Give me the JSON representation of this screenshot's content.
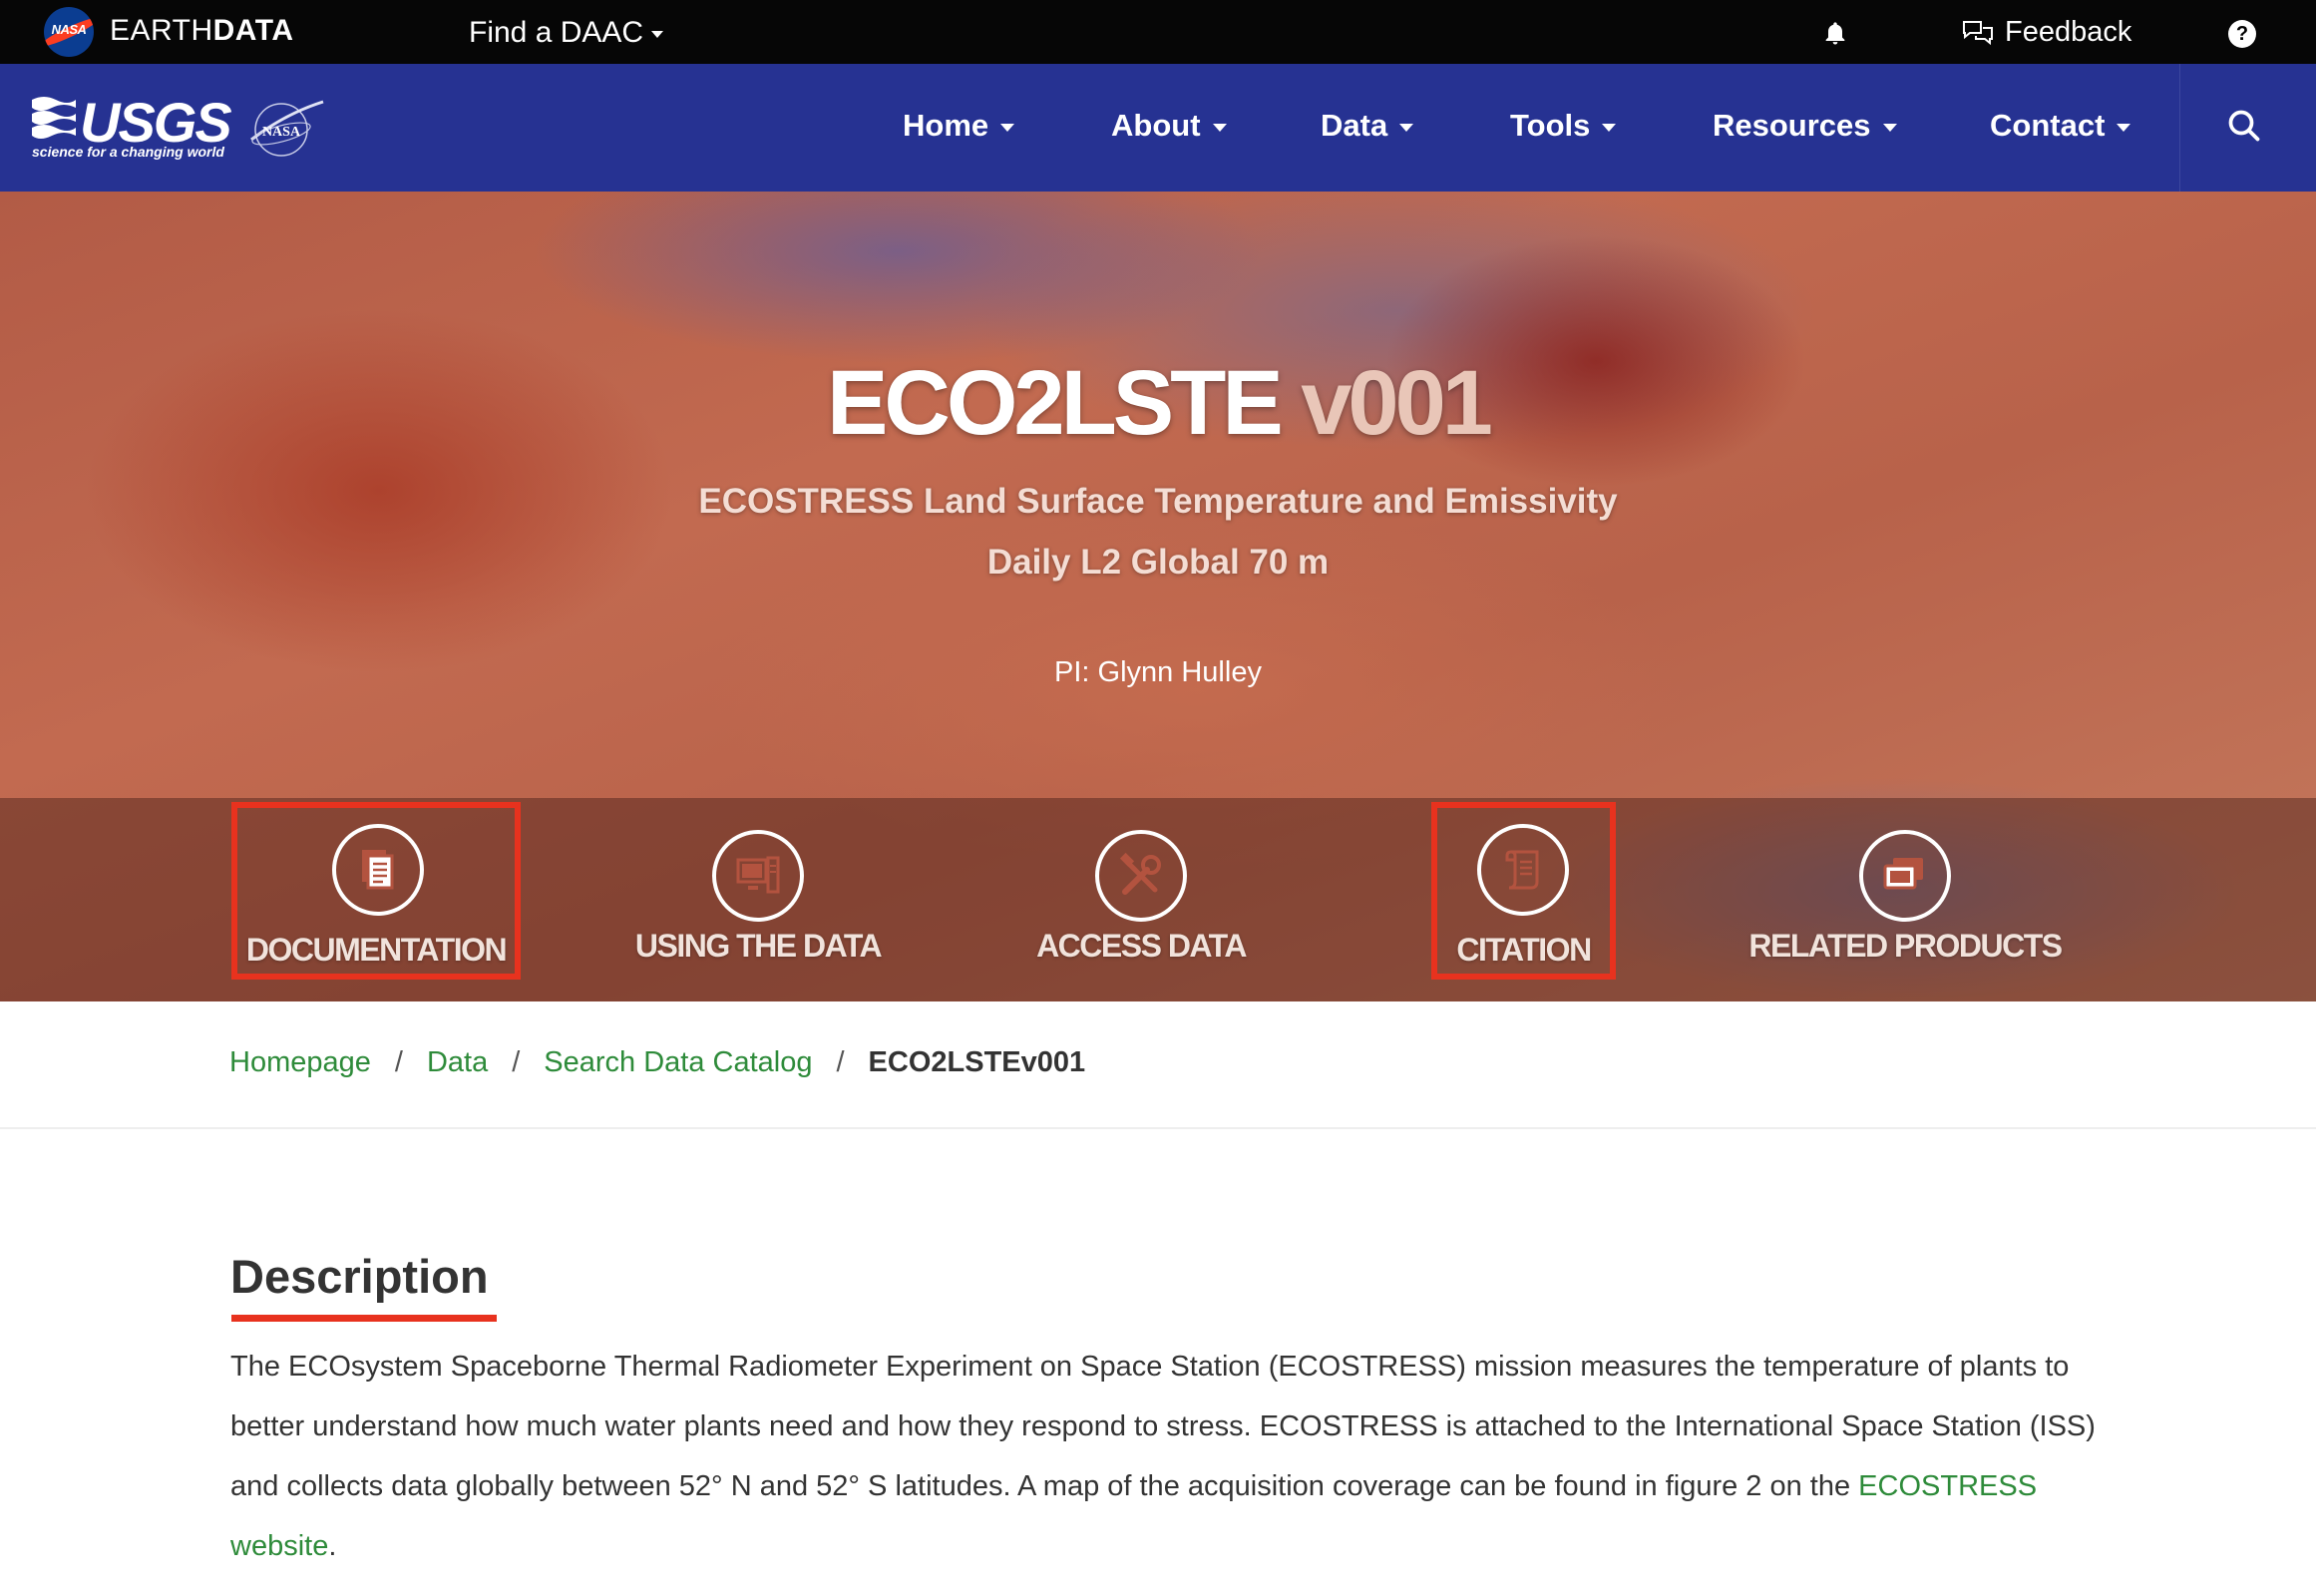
{
  "earthdata": {
    "logo_text": "NASA",
    "brand_light": "EARTH",
    "brand_bold": "DATA",
    "find_daac": "Find a DAAC",
    "feedback": "Feedback",
    "help": "?"
  },
  "usgs": {
    "wordmark": "USGS",
    "tagline": "science for a changing world",
    "nasa_worm": "NASA"
  },
  "nav": {
    "items": [
      {
        "label": "Home"
      },
      {
        "label": "About"
      },
      {
        "label": "Data"
      },
      {
        "label": "Tools"
      },
      {
        "label": "Resources"
      },
      {
        "label": "Contact"
      }
    ]
  },
  "hero": {
    "title": "ECO2LSTE",
    "version": "v001",
    "subtitle_line1": "ECOSTRESS Land Surface Temperature and Emissivity",
    "subtitle_line2": "Daily L2 Global 70 m",
    "pi": "PI: Glynn Hulley",
    "quicklinks": [
      {
        "label": "DOCUMENTATION",
        "icon": "document-icon",
        "highlighted": true
      },
      {
        "label": "USING THE DATA",
        "icon": "computer-icon",
        "highlighted": false
      },
      {
        "label": "ACCESS DATA",
        "icon": "tools-icon",
        "highlighted": false
      },
      {
        "label": "CITATION",
        "icon": "scroll-icon",
        "highlighted": true
      },
      {
        "label": "RELATED PRODUCTS",
        "icon": "monitors-icon",
        "highlighted": false
      }
    ]
  },
  "breadcrumb": {
    "items": [
      "Homepage",
      "Data",
      "Search Data Catalog"
    ],
    "separator": "/",
    "current": "ECO2LSTEv001"
  },
  "description": {
    "heading": "Description",
    "text_before_link": "The ECOsystem Spaceborne Thermal Radiometer Experiment on Space Station (ECOSTRESS) mission measures the temperature of plants to better understand how much water plants need and how they respond to stress. ECOSTRESS is attached to the International Space Station (ISS) and collects data globally between 52° N and 52° S latitudes. A map of the acquisition coverage can be found in figure 2 on the ",
    "link_text": "ECOSTRESS website",
    "text_after_link": "."
  },
  "colors": {
    "topbar": "#060606",
    "navbar": "#263292",
    "highlight_red": "#e8321e",
    "link_green": "#2e8b3a"
  }
}
